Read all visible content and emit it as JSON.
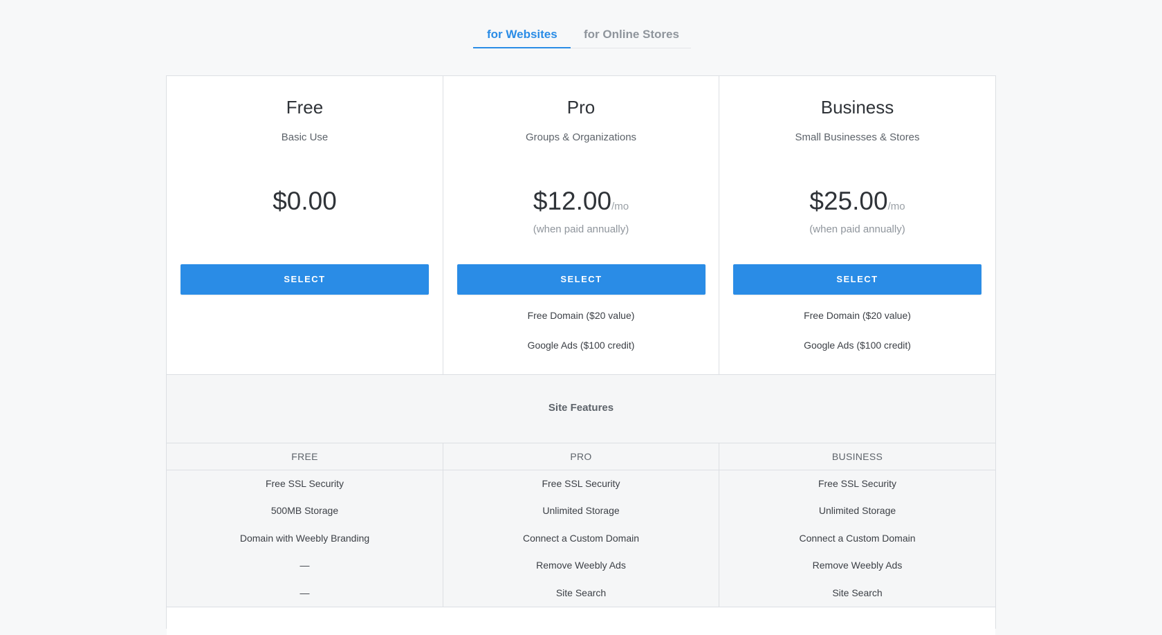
{
  "tabs": [
    {
      "label": "for Websites",
      "active": true
    },
    {
      "label": "for Online Stores",
      "active": false
    }
  ],
  "plans": [
    {
      "name": "Free",
      "subtitle": "Basic Use",
      "price": "$0.00",
      "per": "",
      "note": "",
      "button": "SELECT",
      "perks": []
    },
    {
      "name": "Pro",
      "subtitle": "Groups & Organizations",
      "price": "$12.00",
      "per": "/mo",
      "note": "(when paid annually)",
      "button": "SELECT",
      "perks": [
        "Free Domain ($20 value)",
        "Google Ads ($100 credit)"
      ]
    },
    {
      "name": "Business",
      "subtitle": "Small Businesses & Stores",
      "price": "$25.00",
      "per": "/mo",
      "note": "(when paid annually)",
      "button": "SELECT",
      "perks": [
        "Free Domain ($20 value)",
        "Google Ads ($100 credit)"
      ]
    }
  ],
  "site_features": {
    "title": "Site Features",
    "columns": [
      "FREE",
      "PRO",
      "BUSINESS"
    ],
    "rows": [
      [
        "Free SSL Security",
        "Free SSL Security",
        "Free SSL Security"
      ],
      [
        "500MB Storage",
        "Unlimited Storage",
        "Unlimited Storage"
      ],
      [
        "Domain with Weebly Branding",
        "Connect a Custom Domain",
        "Connect a Custom Domain"
      ],
      [
        "—",
        "Remove Weebly Ads",
        "Remove Weebly Ads"
      ],
      [
        "—",
        "Site Search",
        "Site Search"
      ]
    ]
  },
  "colors": {
    "accent": "#2a8ce6",
    "background": "#f7f8f9",
    "border": "#dcdfe3"
  }
}
